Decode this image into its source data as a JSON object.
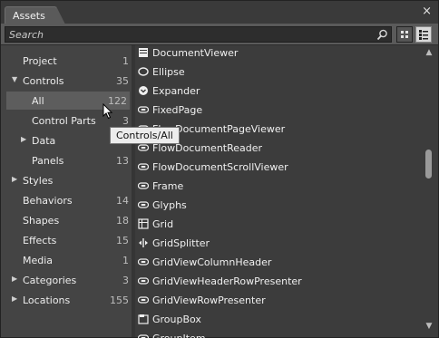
{
  "panel": {
    "tab_title": "Assets",
    "close_glyph": "×"
  },
  "search": {
    "placeholder": "Search",
    "value": ""
  },
  "view_modes": {
    "grid_icon": "grid-view-icon",
    "list_icon": "list-view-icon",
    "selected": "list"
  },
  "categories": [
    {
      "label": "Project",
      "count": "1",
      "expander": "",
      "indent": 0
    },
    {
      "label": "Controls",
      "count": "35",
      "expander": "▼",
      "indent": 0
    },
    {
      "label": "All",
      "count": "122",
      "expander": "",
      "indent": 1,
      "selected": true
    },
    {
      "label": "Control Parts",
      "count": "3",
      "expander": "",
      "indent": 1
    },
    {
      "label": "Data",
      "count": "",
      "expander": "▶",
      "indent": 1
    },
    {
      "label": "Panels",
      "count": "13",
      "expander": "",
      "indent": 1
    },
    {
      "label": "Styles",
      "count": "",
      "expander": "▶",
      "indent": 0
    },
    {
      "label": "Behaviors",
      "count": "14",
      "expander": "",
      "indent": 0
    },
    {
      "label": "Shapes",
      "count": "18",
      "expander": "",
      "indent": 0
    },
    {
      "label": "Effects",
      "count": "15",
      "expander": "",
      "indent": 0
    },
    {
      "label": "Media",
      "count": "1",
      "expander": "",
      "indent": 0
    },
    {
      "label": "Categories",
      "count": "3",
      "expander": "▶",
      "indent": 0
    },
    {
      "label": "Locations",
      "count": "155",
      "expander": "▶",
      "indent": 0
    }
  ],
  "items": [
    {
      "name": "DocumentViewer",
      "icon": "document-viewer-icon"
    },
    {
      "name": "Ellipse",
      "icon": "ellipse-icon"
    },
    {
      "name": "Expander",
      "icon": "expander-icon"
    },
    {
      "name": "FixedPage",
      "icon": "control-icon"
    },
    {
      "name": "FlowDocumentPageViewer",
      "icon": "control-icon"
    },
    {
      "name": "FlowDocumentReader",
      "icon": "control-icon"
    },
    {
      "name": "FlowDocumentScrollViewer",
      "icon": "control-icon"
    },
    {
      "name": "Frame",
      "icon": "control-icon"
    },
    {
      "name": "Glyphs",
      "icon": "control-icon"
    },
    {
      "name": "Grid",
      "icon": "grid-icon"
    },
    {
      "name": "GridSplitter",
      "icon": "grid-splitter-icon"
    },
    {
      "name": "GridViewColumnHeader",
      "icon": "control-icon"
    },
    {
      "name": "GridViewHeaderRowPresenter",
      "icon": "control-icon"
    },
    {
      "name": "GridViewRowPresenter",
      "icon": "control-icon"
    },
    {
      "name": "GroupBox",
      "icon": "group-box-icon"
    },
    {
      "name": "GroupItem",
      "icon": "control-icon"
    }
  ],
  "tooltip": {
    "text": "Controls/All"
  }
}
